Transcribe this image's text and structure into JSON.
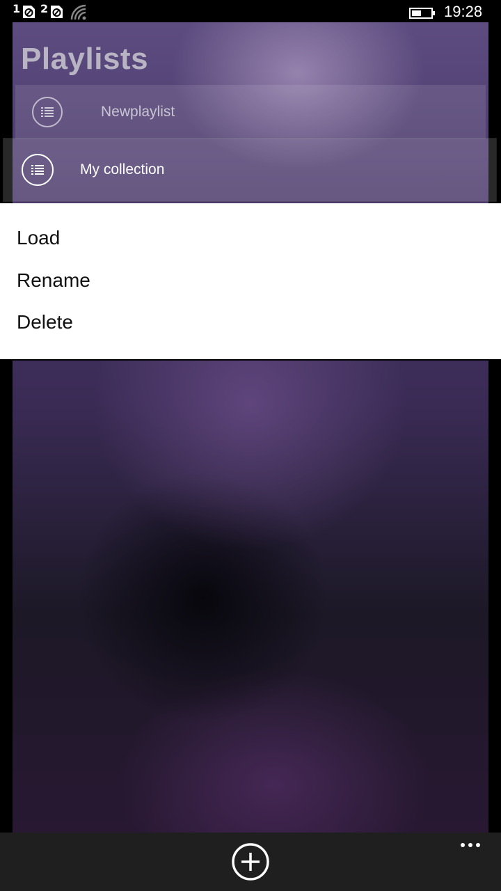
{
  "status_bar": {
    "sim1": "1",
    "sim2": "2",
    "time": "19:28",
    "icons": [
      "sim-no-signal-icon",
      "sim-no-signal-icon",
      "wifi-icon",
      "battery-icon"
    ]
  },
  "page": {
    "title": "Playlists"
  },
  "playlists": [
    {
      "label": "Newplaylist",
      "icon": "playlist-icon"
    },
    {
      "label": "My collection",
      "icon": "playlist-icon"
    }
  ],
  "context_menu": {
    "items": [
      "Load",
      "Rename",
      "Delete"
    ]
  },
  "app_bar": {
    "add_icon": "add-circle-icon",
    "more_icon": "more-ellipsis-icon"
  },
  "colors": {
    "menu_bg": "#ffffff",
    "app_bar_bg": "#1f1f1f",
    "accent_text": "#111111"
  }
}
